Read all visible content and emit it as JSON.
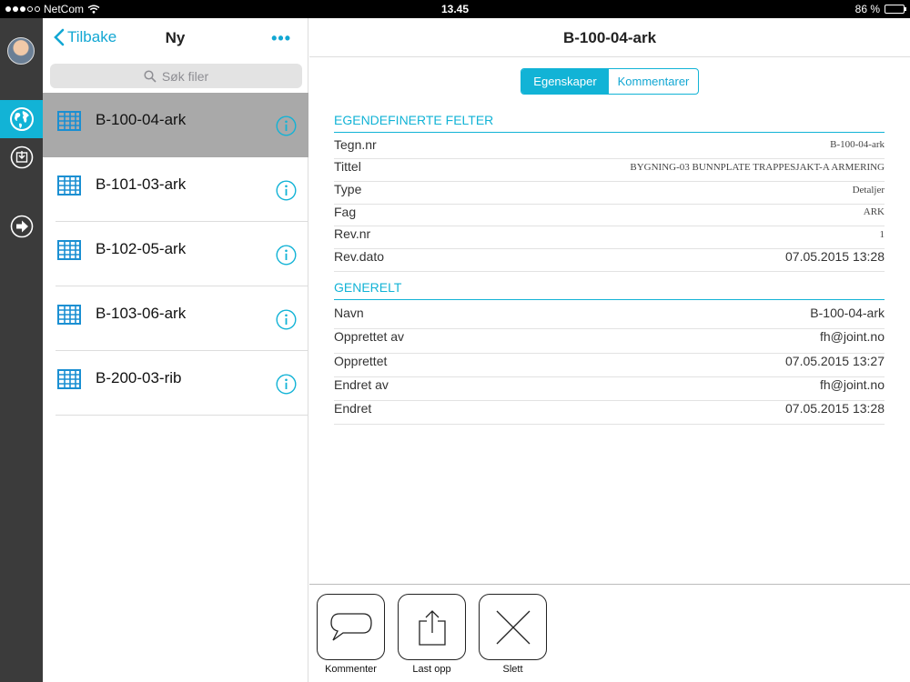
{
  "status_bar": {
    "carrier": "NetCom",
    "time": "13.45",
    "battery": "86 %",
    "battery_level": 0.86
  },
  "rail": {
    "items": [
      {
        "icon": "avatar"
      },
      {
        "icon": "globe-icon",
        "active": true
      },
      {
        "icon": "download-icon"
      },
      {
        "icon": "logout-icon"
      }
    ]
  },
  "list_pane": {
    "back_label": "Tilbake",
    "title": "Ny",
    "more_label": "•••",
    "search_placeholder": "Søk filer",
    "files": [
      {
        "name": "B-100-04-ark",
        "selected": true
      },
      {
        "name": "B-101-03-ark"
      },
      {
        "name": "B-102-05-ark"
      },
      {
        "name": "B-103-06-ark"
      },
      {
        "name": "B-200-03-rib"
      }
    ]
  },
  "detail": {
    "title": "B-100-04-ark",
    "tabs": [
      {
        "label": "Egenskaper",
        "active": true
      },
      {
        "label": "Kommentarer"
      }
    ],
    "custom_fields": {
      "header": "EGENDEFINERTE FELTER",
      "rows": [
        {
          "key": "Tegn.nr",
          "value": "B-100-04-ark"
        },
        {
          "key": "Tittel",
          "value": "BYGNING-03 BUNNPLATE TRAPPESJAKT-A ARMERING"
        },
        {
          "key": "Type",
          "value": "Detaljer"
        },
        {
          "key": "Fag",
          "value": "ARK"
        },
        {
          "key": "Rev.nr",
          "value": "1"
        },
        {
          "key": "Rev.dato",
          "value": "07.05.2015 13:28"
        }
      ]
    },
    "general": {
      "header": "GENERELT",
      "rows": [
        {
          "key": "Navn",
          "value": "B-100-04-ark"
        },
        {
          "key": "Opprettet av",
          "value": "fh@joint.no"
        },
        {
          "key": "Opprettet",
          "value": "07.05.2015 13:27"
        },
        {
          "key": "Endret av",
          "value": "fh@joint.no"
        },
        {
          "key": "Endret",
          "value": "07.05.2015 13:28"
        }
      ]
    },
    "toolbar": {
      "comment_label": "Kommenter",
      "upload_label": "Last opp",
      "delete_label": "Slett"
    }
  },
  "colors": {
    "accent": "#12b3d6",
    "rail_bg": "#3b3b3b",
    "selected_row": "#a9a9a9"
  }
}
